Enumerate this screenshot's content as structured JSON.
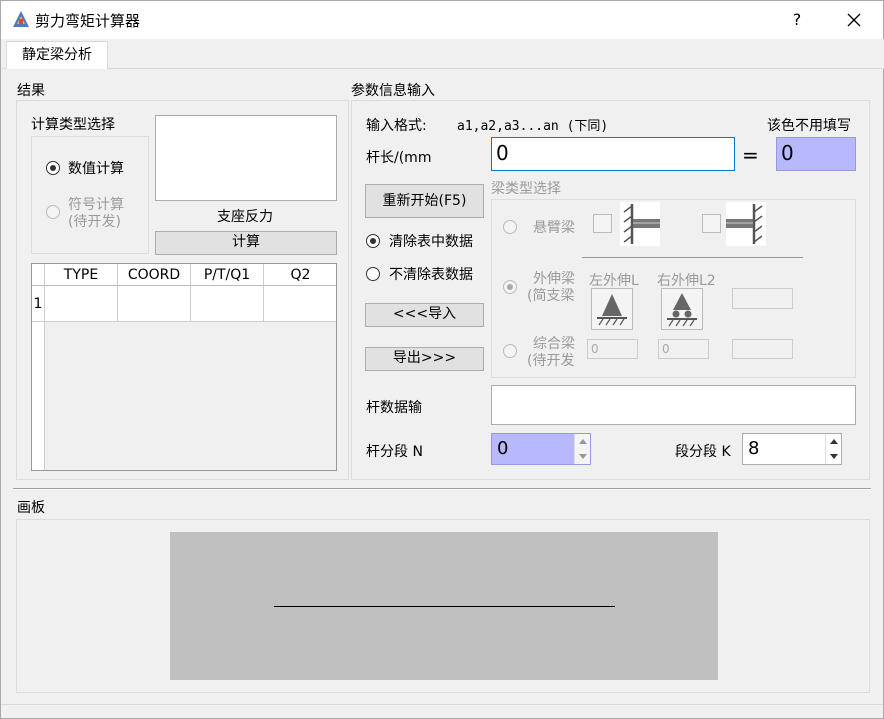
{
  "window": {
    "title": "剪力弯矩计算器",
    "help": "?",
    "close": "✕"
  },
  "tabs": [
    {
      "label": "静定梁分析"
    }
  ],
  "results": {
    "group_label": "结果",
    "calc_type": {
      "label": "计算类型选择",
      "options": [
        {
          "label": "数值计算",
          "checked": true,
          "enabled": true
        },
        {
          "label_line1": "符号计算",
          "label_line2": "(待开发)",
          "checked": false,
          "enabled": false
        }
      ]
    },
    "reaction_label": "支座反力",
    "calc_button": "计算",
    "table": {
      "headers": [
        "TYPE",
        "COORD",
        "P/T/Q1",
        "Q2"
      ],
      "rows": [
        {
          "index": "1",
          "cells": [
            "",
            "",
            "",
            ""
          ]
        }
      ]
    }
  },
  "params": {
    "group_label": "参数信息输入",
    "format_label": "输入格式:",
    "format_value": "a1,a2,a3...an (下同)",
    "color_hint": "该色不用填写",
    "length_label": "杆长/(mm",
    "length_value": "0",
    "equals": "=",
    "length_total": "0",
    "restart_button": "重新开始(F5)",
    "clear_options": [
      {
        "label": "清除表中数据",
        "checked": true
      },
      {
        "label": "不清除表数据",
        "checked": false
      }
    ],
    "import_button": "<<<导入",
    "export_button": "导出>>>",
    "beam_type": {
      "label": "梁类型选择",
      "cantilever": "悬臂梁",
      "overhang_line1": "外伸梁",
      "overhang_line2": "(简支梁",
      "combined_line1": "综合梁",
      "combined_line2": "(待开发",
      "left_overhang": "左外伸L",
      "right_overhang": "右外伸L2",
      "combined_val1": "0",
      "combined_val2": "0"
    },
    "bar_data_label": "杆数据输",
    "bar_data_value": "",
    "segments_label": "杆分段 N",
    "segments_value": "0",
    "seg_count_label": "段分段 K",
    "seg_count_value": "8"
  },
  "canvas": {
    "label": "画板"
  },
  "colors": {
    "accent_fill": "#b8b8ff",
    "canvas_gray": "#c0c0c0",
    "focus_border": "#0078d7"
  }
}
